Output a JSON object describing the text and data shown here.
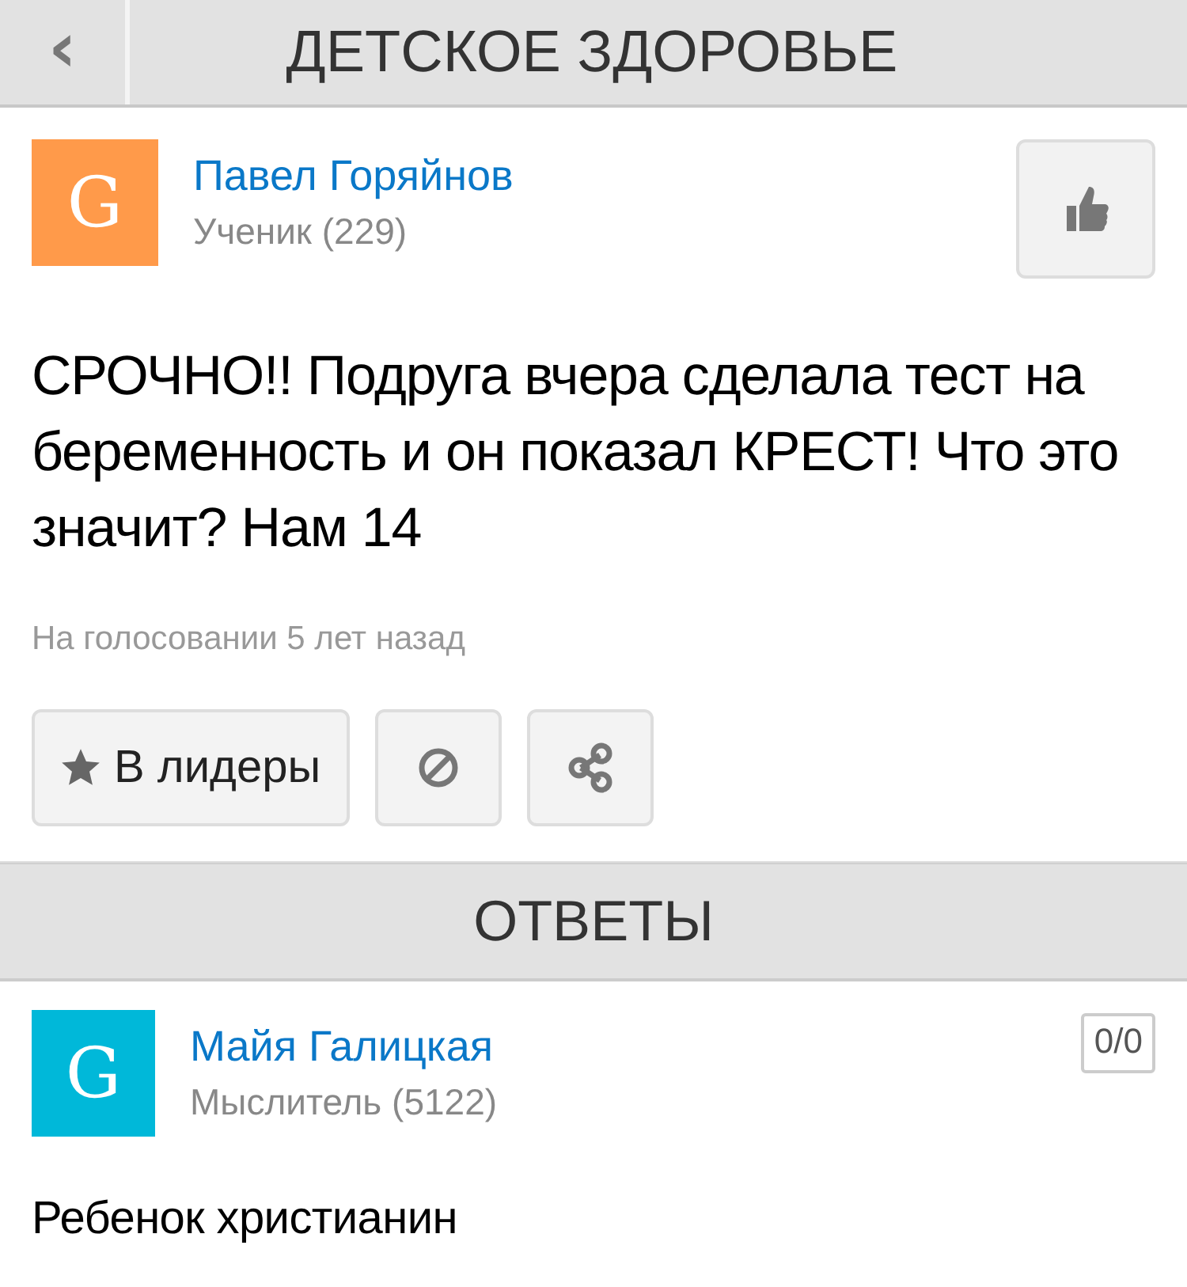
{
  "header": {
    "back_icon": "‹",
    "title": "ДЕТСКОЕ ЗДОРОВЬЕ"
  },
  "question": {
    "author": {
      "avatar_letter": "G",
      "color": "#ff9a4a",
      "name": "Павел Горяйнов",
      "rank": "Ученик (229)"
    },
    "text": "СРОЧНО!! Подруга вчера сделала тест на беременность и он показал КРЕСТ! Что это значит? Нам 14",
    "status": "На голосовании 5 лет назад",
    "actions": [
      {
        "kind": "leaders",
        "label": "В лидеры"
      },
      {
        "kind": "report"
      },
      {
        "kind": "share"
      }
    ]
  },
  "answers_header": "ОТВЕТЫ",
  "answers": [
    {
      "author": {
        "avatar_letter": "G",
        "color": "#00b8d9",
        "name": "Майя Галицкая",
        "rank": "Мыслитель (5122)"
      },
      "score": "0/0",
      "text": "Ребенок христианин"
    }
  ]
}
